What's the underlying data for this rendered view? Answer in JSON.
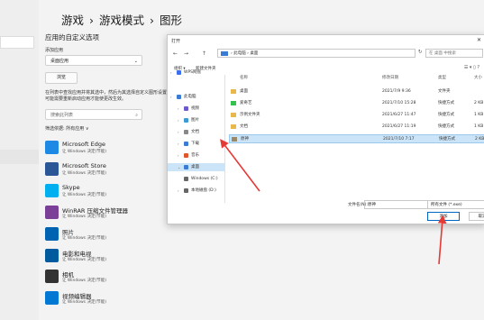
{
  "breadcrumb": {
    "p1": "游戏",
    "sep1": "›",
    "p2": "游戏模式",
    "sep2": "›",
    "p3": "图形"
  },
  "settings": {
    "section_title": "应用的自定义选项",
    "add_label": "添加应用",
    "dropdown_value": "桌面应用",
    "browse_label": "浏览",
    "description": "在列表中查找应用并将其选中，然后为其选择自定义图形设置。可能需要重新启动应用才能使更改生效。",
    "search_placeholder": "搜索此列表",
    "filter_label": "筛选依据: 所有应用 ∨",
    "apps": [
      {
        "name": "Microsoft Edge",
        "status": "让 Windows 决定(节能)",
        "color": "#1e88e5"
      },
      {
        "name": "Microsoft Store",
        "status": "让 Windows 决定(节能)",
        "color": "#2b5797"
      },
      {
        "name": "Skype",
        "status": "让 Windows 决定(节能)",
        "color": "#00aff0"
      },
      {
        "name": "WinRAR 压缩文件管理器",
        "status": "让 Windows 决定(节能)",
        "color": "#7b3f98"
      },
      {
        "name": "照片",
        "status": "让 Windows 决定(节能)",
        "color": "#0063b1"
      },
      {
        "name": "电影和电视",
        "status": "让 Windows 决定(节能)",
        "color": "#005a9e"
      },
      {
        "name": "相机",
        "status": "让 Windows 决定(节能)",
        "color": "#333333"
      },
      {
        "name": "视频编辑器",
        "status": "让 Windows 决定(节能)",
        "color": "#0078d4"
      }
    ]
  },
  "dialog": {
    "title": "打开",
    "close": "✕",
    "back": "←",
    "forward": "→",
    "up": "↑",
    "address": "› 此电脑 › 桌面",
    "refresh": "↻",
    "search_placeholder": "在 桌面 中搜索",
    "toolbar_organize": "组织 ▾",
    "toolbar_new_folder": "新建文件夹",
    "toolbar_right": "☰ ▾ ▯ ?",
    "sidebar": [
      {
        "label": "WPS网盘",
        "color": "#3d6ef0"
      },
      {
        "label": "此电脑",
        "color": "#3a7bd5"
      },
      {
        "label": "视频",
        "color": "#6a5acd"
      },
      {
        "label": "图片",
        "color": "#3a9bd5"
      },
      {
        "label": "文档",
        "color": "#888888"
      },
      {
        "label": "下载",
        "color": "#3a7bd5"
      },
      {
        "label": "音乐",
        "color": "#e0552b"
      },
      {
        "label": "桌面",
        "color": "#3a7bd5"
      },
      {
        "label": "Windows (C:)",
        "color": "#666666"
      },
      {
        "label": "本地磁盘 (D:)",
        "color": "#666666"
      }
    ],
    "columns": {
      "name": "名称",
      "date": "修改日期",
      "type": "类型",
      "size": "大小"
    },
    "files": [
      {
        "name": "桌面",
        "date": "2021/7/9 9:36",
        "type": "文件夹",
        "size": "",
        "icon_color": "#e8b84a"
      },
      {
        "name": "爱奇艺",
        "date": "2021/7/10 15:28",
        "type": "快捷方式",
        "size": "2 KB",
        "icon_color": "#32c24d"
      },
      {
        "name": "示例文件夹",
        "date": "2021/6/27 11:47",
        "type": "快捷方式",
        "size": "1 KB",
        "icon_color": "#e8b84a"
      },
      {
        "name": "文档",
        "date": "2021/6/27 11:19",
        "type": "快捷方式",
        "size": "1 KB",
        "icon_color": "#e8b84a"
      },
      {
        "name": "原神",
        "date": "2021/7/10 7:17",
        "type": "快捷方式",
        "size": "2 KB",
        "icon_color": "#9a8a6a"
      }
    ],
    "filename_label": "文件名(N):",
    "filename_value": "原神",
    "filetype_value": "所有文件 (*.exe)",
    "add_button": "添加",
    "cancel_button": "取消"
  }
}
